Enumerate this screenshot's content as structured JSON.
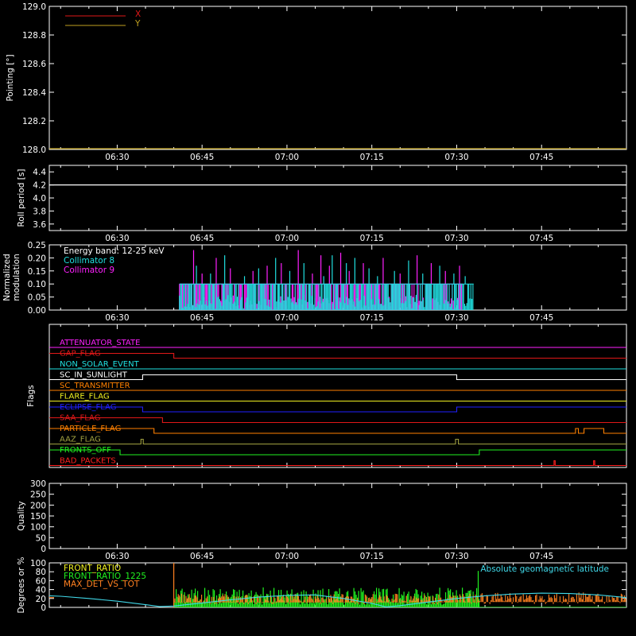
{
  "colors": {
    "axis": "#ffffff",
    "x": "#e01818",
    "y": "#c0a020",
    "col8": "#20e0e0",
    "col9": "#ff20ff",
    "front_ratio": "#f0f020",
    "front_ratio_1225": "#20f020",
    "max_det": "#ff8020",
    "geomag": "#40d8e8"
  },
  "time_ticks": [
    "06:30",
    "06:45",
    "07:00",
    "07:15",
    "07:30",
    "07:45"
  ],
  "time_tick_minutes": [
    30,
    45,
    60,
    75,
    90,
    105
  ],
  "time_range_minutes": [
    18,
    120
  ],
  "chart_data": [
    {
      "type": "line",
      "ylabel": "Pointing [°]",
      "ylim": [
        128.0,
        129.0
      ],
      "yticks": [
        "128.0",
        "128.2",
        "128.4",
        "128.6",
        "128.8",
        "129.0"
      ],
      "ytick_values": [
        128.0,
        128.2,
        128.4,
        128.6,
        128.8,
        129.0
      ],
      "legend": [
        {
          "name": "X",
          "color_key": "x"
        },
        {
          "name": "Y",
          "color_key": "y"
        }
      ],
      "series": [
        {
          "name": "Y",
          "color_key": "y",
          "x": [
            18,
            120
          ],
          "y": [
            128.0,
            128.0
          ]
        }
      ]
    },
    {
      "type": "line",
      "ylabel": "Roll period [s]",
      "ylim": [
        3.5,
        4.5
      ],
      "yticks": [
        "3.6",
        "3.8",
        "4.0",
        "4.2",
        "4.4"
      ],
      "ytick_values": [
        3.6,
        3.8,
        4.0,
        4.2,
        4.4
      ],
      "series": [
        {
          "x": [
            18,
            120
          ],
          "y": [
            4.2,
            4.2
          ]
        }
      ]
    },
    {
      "type": "line",
      "ylabel": "Normalized modulation",
      "ylabel_lines": [
        "Normalized",
        "modulation"
      ],
      "ylim": [
        0.0,
        0.25
      ],
      "yticks": [
        "0.00",
        "0.05",
        "0.10",
        "0.15",
        "0.20",
        "0.25"
      ],
      "ytick_values": [
        0.0,
        0.05,
        0.1,
        0.15,
        0.2,
        0.25
      ],
      "annotation": "Energy band: 12-25 keV",
      "series": [
        {
          "name": "Collimator 8",
          "color_key": "col8",
          "x_range": [
            41,
            93
          ],
          "base": 0.1,
          "spike_x": [
            44,
            46.5,
            49,
            52.5,
            55,
            58,
            60.5,
            63,
            66.5,
            68,
            70.5,
            72,
            74.5,
            76,
            79,
            81.5,
            84,
            87,
            89.5,
            91.5
          ],
          "spike_y": [
            0.17,
            0.14,
            0.21,
            0.13,
            0.16,
            0.2,
            0.15,
            0.18,
            0.13,
            0.21,
            0.18,
            0.2,
            0.16,
            0.13,
            0.15,
            0.19,
            0.14,
            0.17,
            0.14,
            0.13
          ]
        },
        {
          "name": "Collimator 9",
          "color_key": "col9",
          "x_range": [
            41,
            91
          ],
          "base": 0.1,
          "spike_x": [
            43.5,
            45,
            47.5,
            50,
            54,
            56.5,
            59,
            62,
            64.5,
            66,
            67.5,
            69.5,
            71,
            73.5,
            77,
            80,
            83,
            85.5,
            88,
            90.5
          ],
          "spike_y": [
            0.23,
            0.14,
            0.2,
            0.16,
            0.15,
            0.17,
            0.18,
            0.23,
            0.14,
            0.21,
            0.17,
            0.22,
            0.15,
            0.18,
            0.2,
            0.14,
            0.21,
            0.18,
            0.15,
            0.17
          ]
        }
      ]
    },
    {
      "type": "line",
      "ylabel": "Flags",
      "series": [
        {
          "name": "ATTENUATOR_STATE",
          "color_key": "col9",
          "steps": [
            [
              18,
              0
            ]
          ]
        },
        {
          "name": "GAP_FLAG",
          "color_key": "x",
          "steps": [
            [
              18,
              1
            ],
            [
              40,
              0
            ]
          ]
        },
        {
          "name": "NON_SOLAR_EVENT",
          "color_key": "col8",
          "steps": [
            [
              18,
              0
            ]
          ]
        },
        {
          "name": "SC_IN_SUNLIGHT",
          "color": "#ffffff",
          "steps": [
            [
              18,
              0
            ],
            [
              34.5,
              1
            ],
            [
              90,
              0
            ]
          ]
        },
        {
          "name": "SC_TRANSMITTER",
          "color": "#ff8000",
          "steps": [
            [
              18,
              0
            ]
          ]
        },
        {
          "name": "FLARE_FLAG",
          "color": "#f0f020",
          "steps": [
            [
              18,
              0
            ]
          ]
        },
        {
          "name": "ECLIPSE_FLAG",
          "color": "#2020ff",
          "steps": [
            [
              18,
              1
            ],
            [
              34.5,
              0
            ],
            [
              90,
              1
            ]
          ]
        },
        {
          "name": "SAA_FLAG",
          "color": "#e01818",
          "steps": [
            [
              18,
              1
            ],
            [
              38,
              0
            ]
          ]
        },
        {
          "name": "PARTICLE_FLAG",
          "color": "#ff8000",
          "steps": [
            [
              18,
              1
            ],
            [
              36.5,
              0
            ],
            [
              111,
              1
            ],
            [
              111.5,
              0
            ],
            [
              112.5,
              1
            ],
            [
              116,
              0
            ]
          ]
        },
        {
          "name": "AAZ_FLAG",
          "color": "#a0a040",
          "steps": [
            [
              18,
              0
            ],
            [
              34.2,
              1
            ],
            [
              34.6,
              0
            ],
            [
              89.8,
              1
            ],
            [
              90.3,
              0
            ]
          ]
        },
        {
          "name": "FRONTS_OFF",
          "color": "#20f020",
          "steps": [
            [
              18,
              1
            ],
            [
              30.5,
              0
            ],
            [
              94,
              1
            ]
          ]
        },
        {
          "name": "BAD_PACKETS",
          "color": "#ff2020",
          "steps": [
            [
              18,
              0
            ],
            [
              107.2,
              1
            ],
            [
              107.4,
              0
            ],
            [
              114.2,
              1
            ],
            [
              114.4,
              0
            ]
          ]
        }
      ]
    },
    {
      "type": "line",
      "ylabel": "Quality",
      "ylim": [
        0,
        300
      ],
      "yticks": [
        "0",
        "50",
        "100",
        "150",
        "200",
        "250",
        "300"
      ],
      "ytick_values": [
        0,
        50,
        100,
        150,
        200,
        250,
        300
      ],
      "series": []
    },
    {
      "type": "line",
      "ylabel": "Degrees or %",
      "ylim": [
        0,
        100
      ],
      "yticks": [
        "0",
        "20",
        "40",
        "60",
        "80",
        "100"
      ],
      "ytick_values": [
        0,
        20,
        40,
        60,
        80,
        100
      ],
      "annotation": "Absolute geomagnetic latitude",
      "series": [
        {
          "name": "FRONT_RATIO",
          "color_key": "front_ratio"
        },
        {
          "name": "FRONT_RATIO_1225",
          "color_key": "front_ratio_1225",
          "x_range": [
            40,
            94
          ],
          "level": 30,
          "peak": {
            "x": 93.8,
            "y": 82
          }
        },
        {
          "name": "MAX_DET_VS_TOT",
          "color_key": "max_det",
          "x_range": [
            40,
            120
          ],
          "level": 22,
          "spike": {
            "x": 40,
            "y": 100
          }
        },
        {
          "name": "Absolute geomagnetic latitude",
          "color_key": "geomag",
          "x": [
            18,
            20,
            25,
            30,
            35,
            37.5,
            40,
            45,
            50,
            55,
            60,
            65,
            70,
            75,
            77.5,
            80,
            85,
            90,
            95,
            100,
            105,
            110,
            115,
            120
          ],
          "y": [
            26,
            25,
            20,
            14,
            6,
            2,
            3,
            10,
            17,
            23,
            27,
            28,
            20,
            9,
            1,
            4,
            12,
            20,
            26,
            30,
            32,
            31,
            28,
            22
          ]
        }
      ]
    }
  ]
}
